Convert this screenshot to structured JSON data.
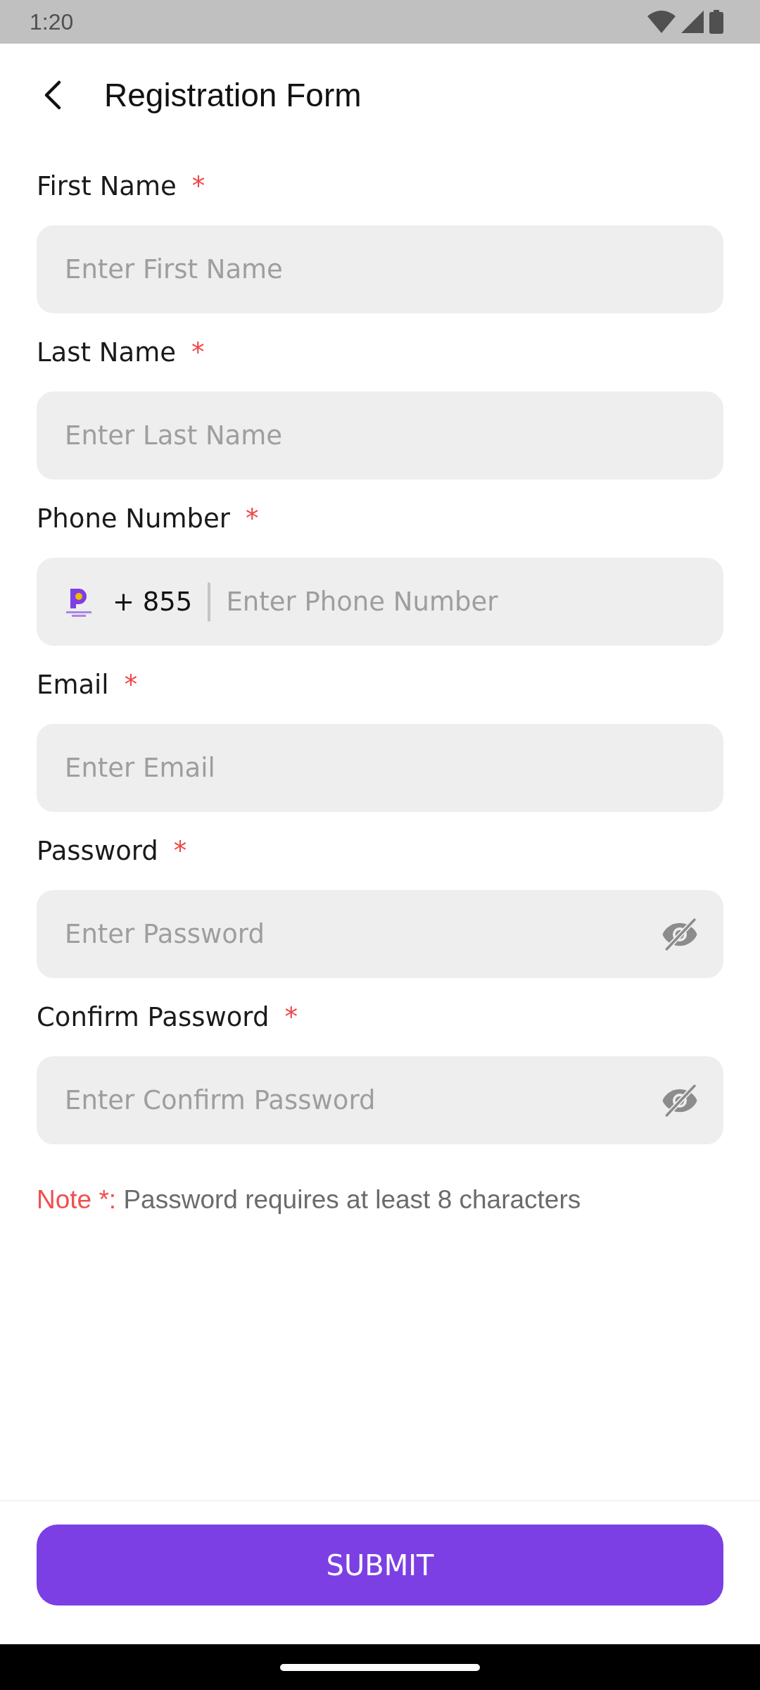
{
  "status_bar": {
    "time": "1:20"
  },
  "header": {
    "title": "Registration Form"
  },
  "fields": [
    {
      "kind": "text",
      "label": "First Name",
      "required_mark": "*",
      "placeholder": "Enter First Name"
    },
    {
      "kind": "text",
      "label": "Last Name",
      "required_mark": "*",
      "placeholder": "Enter Last Name"
    },
    {
      "kind": "phone",
      "label": "Phone Number",
      "required_mark": "*",
      "country_code": "+ 855",
      "placeholder": "Enter Phone Number"
    },
    {
      "kind": "text",
      "label": "Email",
      "required_mark": "*",
      "placeholder": "Enter Email"
    },
    {
      "kind": "password",
      "label": "Password",
      "required_mark": "*",
      "placeholder": "Enter Password"
    },
    {
      "kind": "password",
      "label": "Confirm Password",
      "required_mark": "*",
      "placeholder": "Enter Confirm Password"
    }
  ],
  "note": {
    "prefix": "Note *:",
    "text": "Password requires at least 8 characters"
  },
  "submit_button": {
    "label": "SUBMIT"
  }
}
